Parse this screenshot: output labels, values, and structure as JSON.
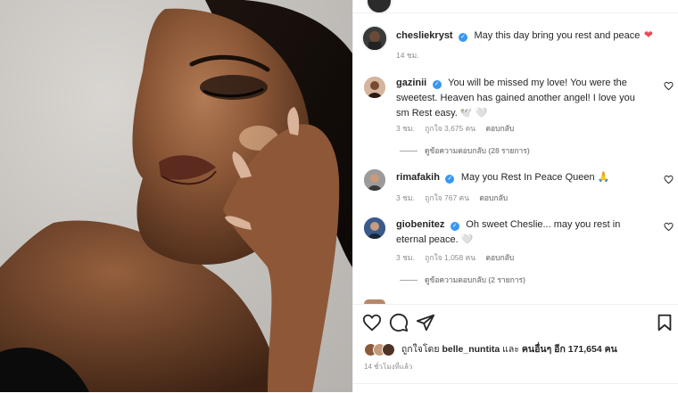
{
  "post": {
    "author": "chesliekryst",
    "caption": "May this day bring you rest and peace",
    "caption_emoji": "❤️",
    "time": "14 ชม."
  },
  "comments": [
    {
      "username": "gazinii",
      "text": "You will be missed my love! You were the sweetest. Heaven has gained another angel! I love you sm Rest easy. 🕊️ 🤍",
      "time": "3 ชม.",
      "likes": "ถูกใจ 3,675 คน",
      "reply": "ตอบกลับ",
      "view_replies": "ดูข้อความตอบกลับ (28 รายการ)"
    },
    {
      "username": "rimafakih",
      "text": "May you Rest In Peace Queen 🙏",
      "time": "3 ชม.",
      "likes": "ถูกใจ 767 คน",
      "reply": "ตอบกลับ"
    },
    {
      "username": "giobenitez",
      "text": "Oh sweet Cheslie... may you rest in eternal peace. 🤍",
      "time": "3 ชม.",
      "likes": "ถูกใจ 1,058 คน",
      "reply": "ตอบกลับ",
      "view_replies": "ดูข้อความตอบกลับ (2 รายการ)"
    }
  ],
  "footer": {
    "liked_by_prefix": "ถูกใจโดย",
    "liked_by_user": "belle_nuntita",
    "liked_by_and": "และ",
    "liked_by_others": "คนอื่นๆ อีก 171,654 คน",
    "time_ago": "14 ชั่วโมงที่แล้ว"
  },
  "colors": {
    "verified": "#3897f0",
    "heart_red": "#ed4956",
    "muted": "#8e8e8e",
    "text": "#262626"
  },
  "icons": [
    "heart-icon",
    "comment-icon",
    "share-icon",
    "bookmark-icon",
    "verified-badge-icon"
  ]
}
